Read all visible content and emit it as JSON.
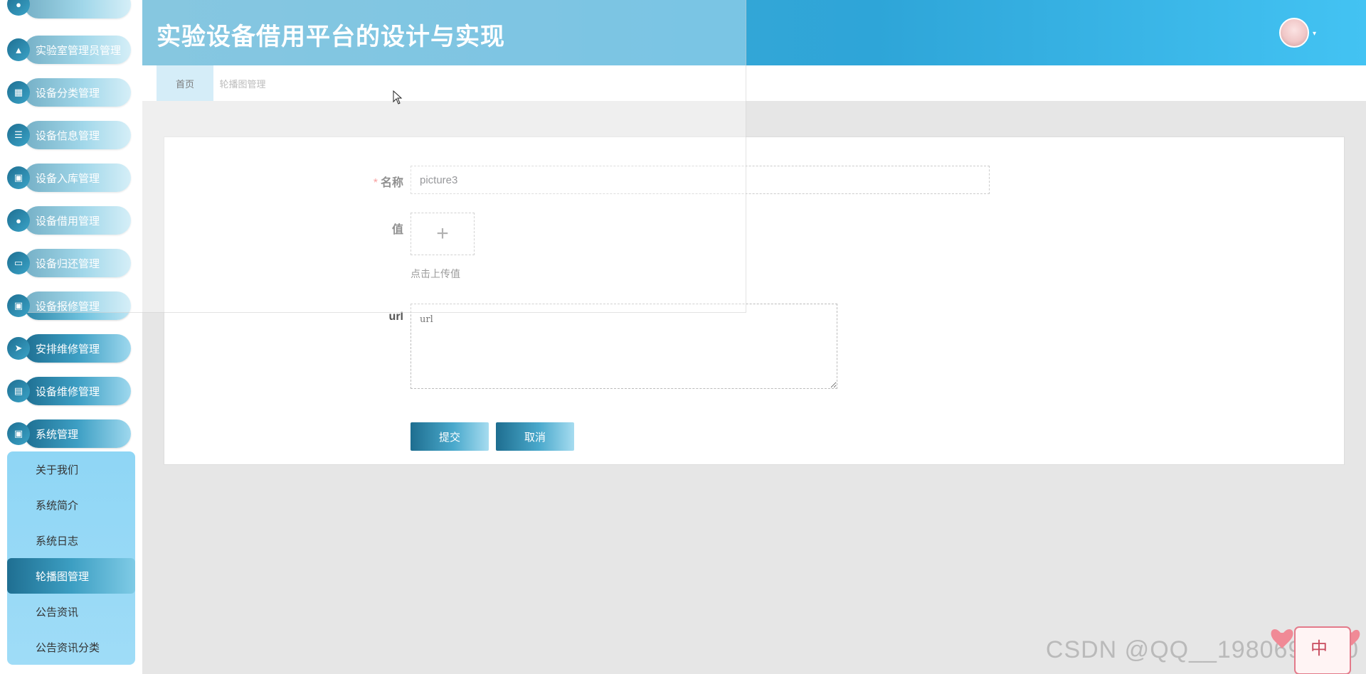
{
  "header": {
    "title": "实验设备借用平台的设计与实现",
    "avatar_caret": "▾"
  },
  "sidebar": {
    "items": [
      {
        "label": "实验室管理员管理",
        "icon": "user-icon"
      },
      {
        "label": "设备分类管理",
        "icon": "grid-icon"
      },
      {
        "label": "设备信息管理",
        "icon": "list-icon"
      },
      {
        "label": "设备入库管理",
        "icon": "apps-icon"
      },
      {
        "label": "设备借用管理",
        "icon": "pin-icon"
      },
      {
        "label": "设备归还管理",
        "icon": "monitor-icon"
      },
      {
        "label": "设备报修管理",
        "icon": "apps-icon"
      },
      {
        "label": "安排维修管理",
        "icon": "send-icon"
      },
      {
        "label": "设备维修管理",
        "icon": "clipboard-icon"
      },
      {
        "label": "系统管理",
        "icon": "apps-icon"
      }
    ],
    "submenu": [
      {
        "label": "关于我们"
      },
      {
        "label": "系统简介"
      },
      {
        "label": "系统日志"
      },
      {
        "label": "轮播图管理"
      },
      {
        "label": "公告资讯"
      },
      {
        "label": "公告资讯分类"
      }
    ]
  },
  "tabs": [
    {
      "label": "首页"
    },
    {
      "label": "轮播图管理"
    }
  ],
  "form": {
    "name_label": "名称",
    "name_required": "*",
    "name_value": "picture3",
    "value_label": "值",
    "upload_plus": "+",
    "upload_hint": "点击上传值",
    "url_label": "url",
    "url_placeholder": "url",
    "submit_label": "提交",
    "cancel_label": "取消"
  },
  "watermark": "CSDN @QQ__1980691580",
  "colors": {
    "header_start": "#46a9d0",
    "header_end": "#43c3f3",
    "accent": "#2c86a8",
    "submenu_bg": "#8fd6f5",
    "required": "#f56c6c"
  }
}
